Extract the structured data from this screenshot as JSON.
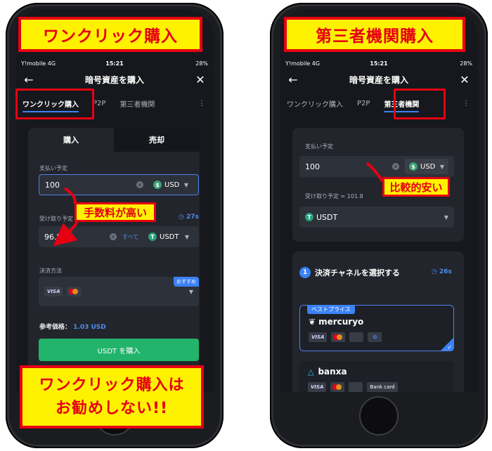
{
  "left": {
    "banner_top": "ワンクリック購入",
    "banner_bottom_line1": "ワンクリック購入は",
    "banner_bottom_line2": "お勧めしない!!",
    "callout": "手数料が高い",
    "status": {
      "carrier": "Y!mobile 4G",
      "time": "15:21",
      "battery": "28%"
    },
    "appbar": {
      "title": "暗号資産を購入",
      "back_icon": "arrow-left-icon",
      "close_icon": "close-icon"
    },
    "tabs": [
      "ワンクリック購入",
      "P2P",
      "第三者機関"
    ],
    "active_tab": 0,
    "more": "⋮",
    "segment": {
      "buy": "購入",
      "sell": "売却"
    },
    "pay_label": "支払い予定",
    "pay_value": "100",
    "pay_currency": "USD",
    "receive_label": "受け取り予定",
    "timer": "27s",
    "receive_value": "96.5",
    "all_label": "すべて",
    "receive_currency": "USDT",
    "method_label": "決済方法",
    "recommend_badge": "おすすめ",
    "visa": "VISA",
    "ref_label": "参考価格：",
    "ref_value": "1.03 USD",
    "buy_button": "USDT を購入"
  },
  "right": {
    "banner_top": "第三者機関購入",
    "callout": "比較的安い",
    "status": {
      "carrier": "Y!mobile 4G",
      "time": "15:21",
      "battery": "28%"
    },
    "appbar": {
      "title": "暗号資産を購入",
      "back_icon": "arrow-left-icon",
      "close_icon": "close-icon"
    },
    "tabs": [
      "ワンクリック購入",
      "P2P",
      "第三者機関"
    ],
    "active_tab": 2,
    "more": "⋮",
    "pay_label": "支払い予定",
    "pay_value": "100",
    "pay_currency": "USD",
    "receive_label": "受け取り予定 ≈ 101.8",
    "receive_currency": "USDT",
    "step_num": "1",
    "step_title": "決済チャネルを選択する",
    "timer": "26s",
    "best_badge": "ベストプライス",
    "provider1": "mercuryo",
    "provider2": "banxa",
    "bank_card": "Bank card",
    "visa": "VISA",
    "apple": "",
    "google": "G"
  },
  "colors": {
    "accent_red": "#e60012",
    "highlight_yellow": "#fff200",
    "brand_green": "#22b46b",
    "link_blue": "#3b82f6"
  }
}
